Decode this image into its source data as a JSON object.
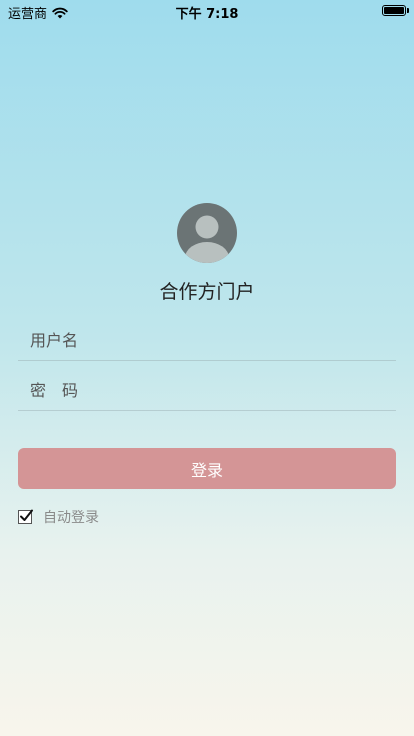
{
  "status_bar": {
    "carrier": "运营商",
    "time": "下午 7:18"
  },
  "login": {
    "title": "合作方门户",
    "username_placeholder": "用户名",
    "password_placeholder": "密　码",
    "login_label": "登录",
    "auto_login_label": "自动登录",
    "auto_login_checked": true
  },
  "colors": {
    "login_button": "#d49596",
    "avatar_bg": "#6b7475",
    "gradient_top": "#9fdced",
    "gradient_bottom": "#f8f5ec"
  },
  "icons": {
    "avatar": "avatar-icon",
    "wifi": "wifi-icon",
    "battery": "battery-icon",
    "checkbox": "checkmark-icon"
  }
}
